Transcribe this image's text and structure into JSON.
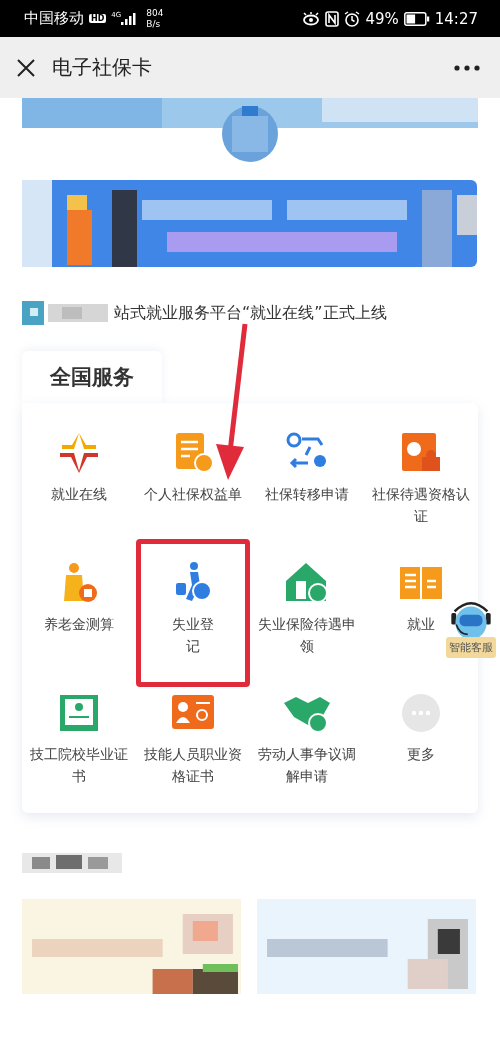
{
  "status_bar": {
    "carrier": "中国移动",
    "hd": "HD",
    "network": "4G",
    "speed": "804",
    "speed_unit": "B/s",
    "battery": "49%",
    "time": "14:27"
  },
  "nav": {
    "title": "电子社保卡"
  },
  "headline": "站式就业服务平台“就业在线”正式上线",
  "services": {
    "title": "全国服务",
    "items": [
      {
        "label": "就业在线",
        "highlighted": false
      },
      {
        "label": "个人社保权益单",
        "highlighted": false
      },
      {
        "label": "社保转移申请",
        "highlighted": false
      },
      {
        "label": "社保待遇资格认证",
        "highlighted": false
      },
      {
        "label": "养老金测算",
        "highlighted": false
      },
      {
        "label": "失业登记",
        "highlighted": true
      },
      {
        "label": "失业保险待遇申领",
        "highlighted": false
      },
      {
        "label": "就业",
        "highlighted": false
      },
      {
        "label": "技工院校毕业证书",
        "highlighted": false
      },
      {
        "label": "技能人员职业资格证书",
        "highlighted": false
      },
      {
        "label": "劳动人事争议调解申请",
        "highlighted": false
      },
      {
        "label": "更多",
        "highlighted": false
      }
    ]
  },
  "assistant": {
    "label": "智能客服"
  }
}
